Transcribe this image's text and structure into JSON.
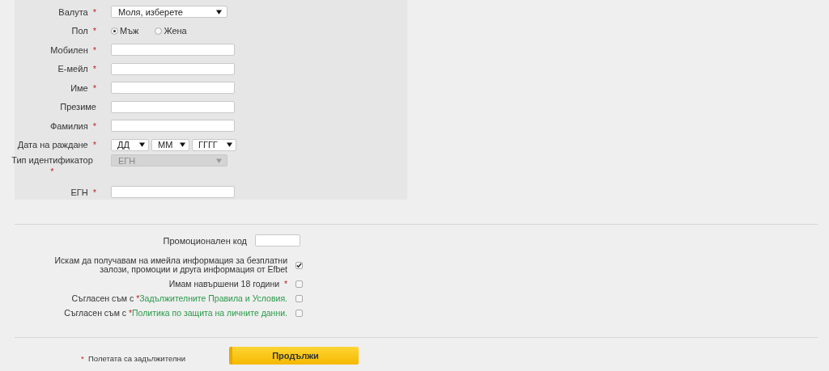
{
  "fields": [
    {
      "kind": "select",
      "label": "Валута",
      "mark": "*",
      "value": "Моля, изберете",
      "disabled": false
    },
    {
      "kind": "radio",
      "label": "Пол",
      "mark": "*",
      "options": [
        {
          "label": "Мъж",
          "selected": true
        },
        {
          "label": "Жена",
          "selected": false
        }
      ]
    },
    {
      "kind": "text",
      "label": "Мобилен",
      "mark": "*"
    },
    {
      "kind": "text",
      "label": "Е-мейл",
      "mark": "*"
    },
    {
      "kind": "text",
      "label": "Име",
      "mark": "*"
    },
    {
      "kind": "text",
      "label": "Презиме"
    },
    {
      "kind": "text",
      "label": "Фамилия",
      "mark": "*"
    },
    {
      "kind": "date",
      "label": "Дата на раждане",
      "mark": "*",
      "parts": [
        "ДД",
        "ММ",
        "ГГГГ"
      ]
    },
    {
      "kind": "select",
      "label": "Тип идентификатор",
      "mark": "*",
      "value": "ЕГН",
      "disabled": true
    },
    {
      "kind": "text",
      "label": "ЕГН",
      "mark": "*"
    }
  ],
  "promo": {
    "label": "Промоционален код"
  },
  "consents": [
    {
      "text": "Искам да получавам на имейла информация за безплатни залози, промоции и друга информация от Efbet",
      "checked": true
    },
    {
      "text": "Имам навършени 18 години",
      "mark": "*",
      "checked": false
    },
    {
      "text": "Съгласен съм с",
      "mark": "*",
      "link": "Задължителните Правила и Условия.",
      "checked": false
    },
    {
      "text": "Съгласен съм с",
      "mark": "*",
      "link": "Политика по защита на личните данни.",
      "checked": false
    }
  ],
  "footer": {
    "mark": "*",
    "note": "Полетата са задължителни",
    "button": "Продължи"
  }
}
